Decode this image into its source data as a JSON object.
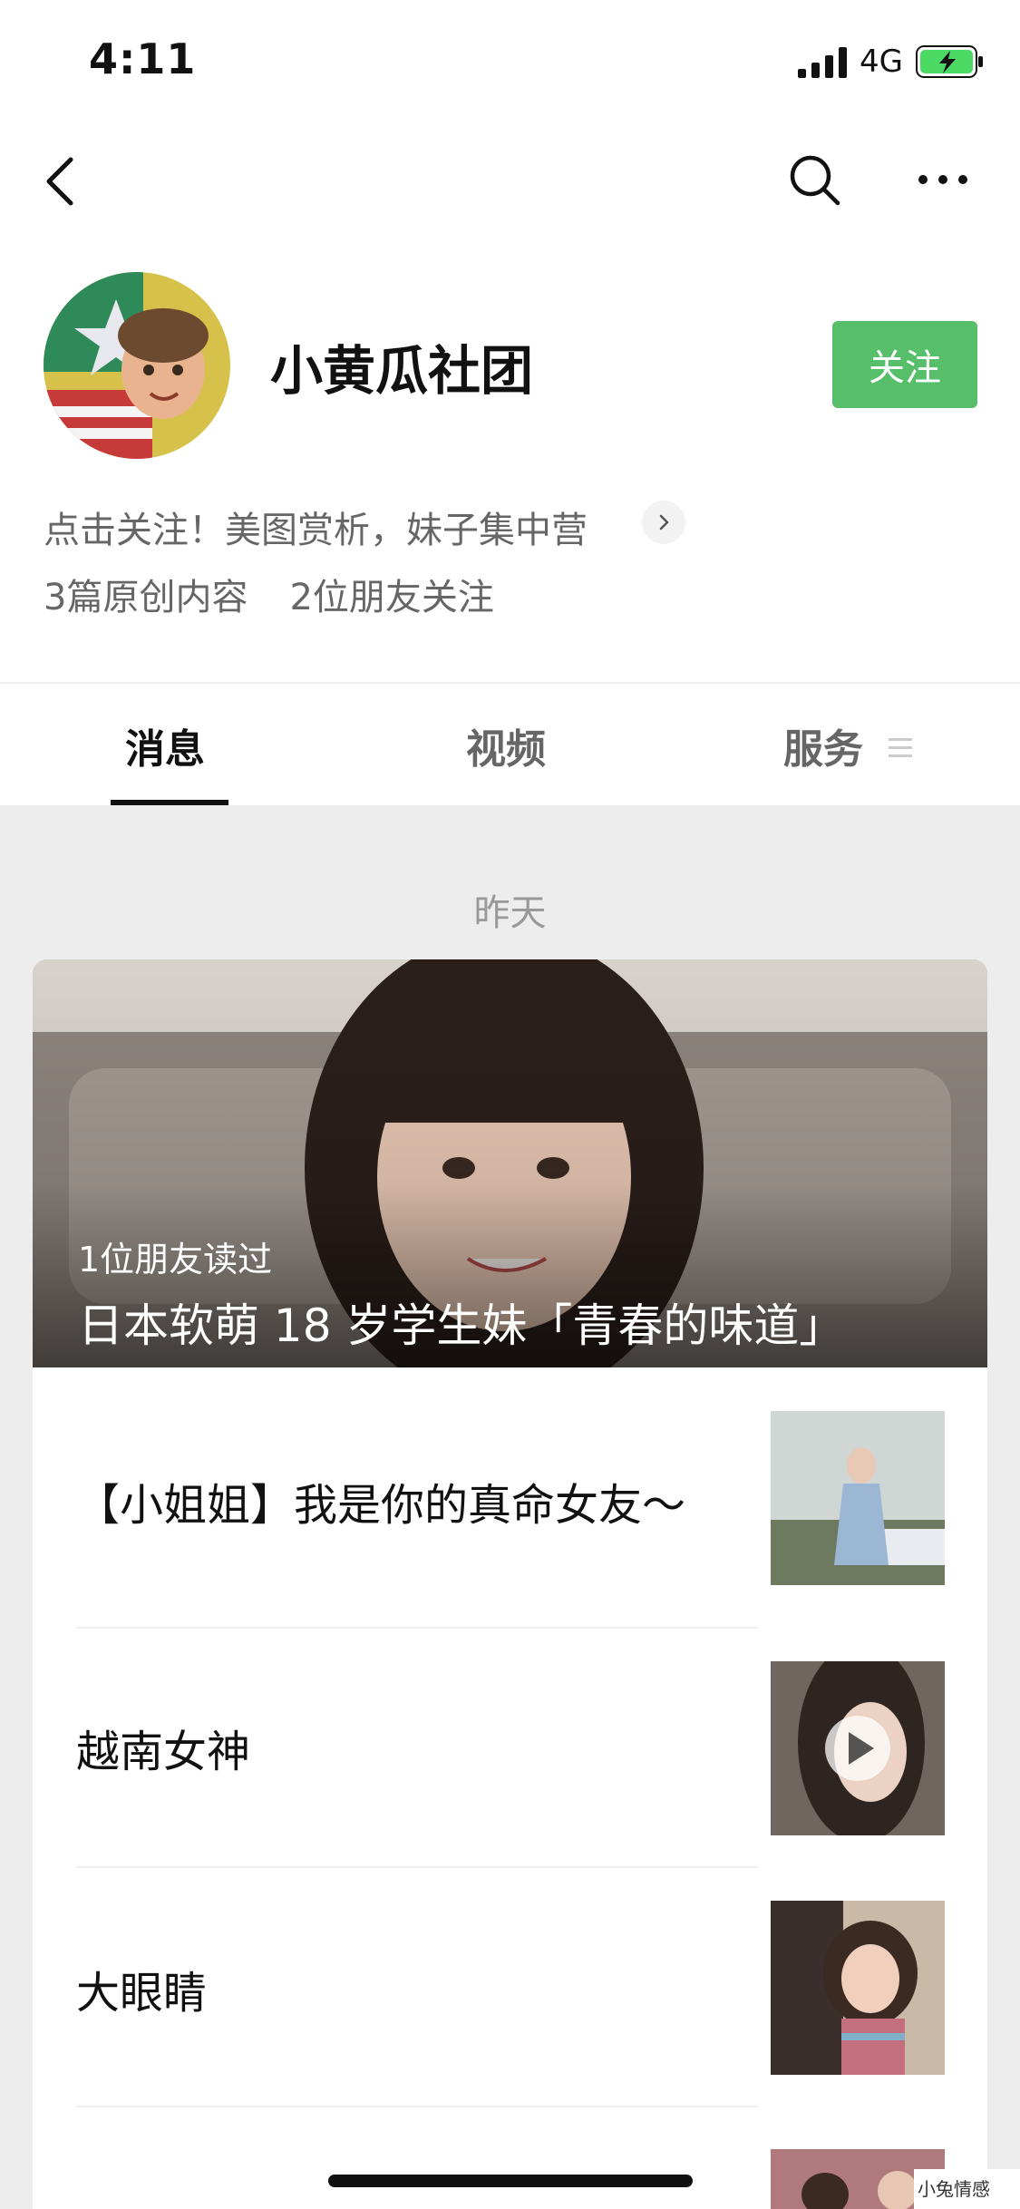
{
  "status_bar": {
    "time": "4:11",
    "network": "4G"
  },
  "account": {
    "name": "小黄瓜社团",
    "follow_label": "关注",
    "description": "点击关注！美图赏析，妹子集中营",
    "original_count": "3篇原创内容",
    "friends_following": "2位朋友关注"
  },
  "tabs": [
    {
      "label": "消息",
      "active": true
    },
    {
      "label": "视频",
      "active": false
    },
    {
      "label": "服务",
      "active": false
    }
  ],
  "feed": {
    "date_label": "昨天",
    "hero": {
      "readers": "1位朋友读过",
      "title": "日本软萌 18 岁学生妹「青春的味道」"
    },
    "articles": [
      {
        "title": "【小姐姐】我是你的真命女友～",
        "has_video": false
      },
      {
        "title": "越南女神",
        "has_video": true
      },
      {
        "title": "大眼睛",
        "has_video": false
      }
    ]
  },
  "watermark": "小兔情感",
  "colors": {
    "accent_green": "#57be6a",
    "background": "#ededed"
  }
}
